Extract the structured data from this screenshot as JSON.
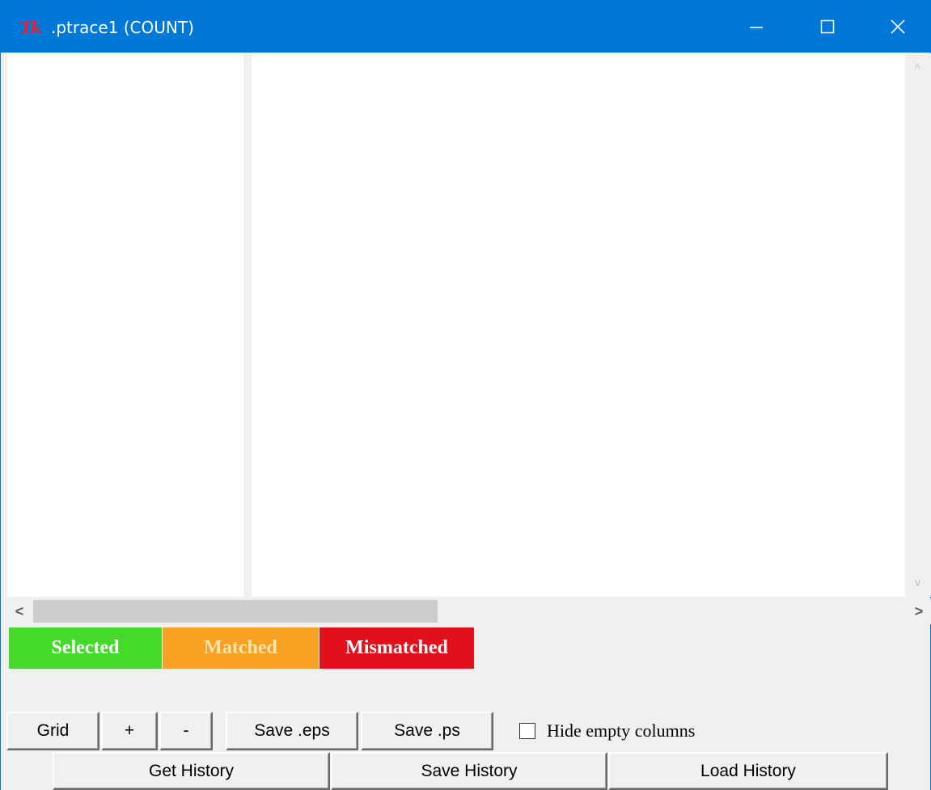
{
  "window": {
    "title": ".ptrace1 (COUNT)",
    "logo_text": "Tk",
    "controls": {
      "minimize_icon": "minimize-icon",
      "maximize_icon": "maximize-icon",
      "close_icon": "close-icon"
    },
    "accent_color": "#0078d7"
  },
  "scrollbars": {
    "vertical": {
      "up_glyph": "^",
      "down_glyph": "v"
    },
    "horizontal": {
      "left_glyph": "<",
      "right_glyph": ">"
    }
  },
  "legend": [
    {
      "label": "Selected",
      "bg": "#45d92b",
      "fg": "#ffffff"
    },
    {
      "label": "Matched",
      "bg": "#f8a122",
      "fg": "#fde5b0"
    },
    {
      "label": "Mismatched",
      "bg": "#e0101d",
      "fg": "#ffffff"
    }
  ],
  "toolbar": {
    "grid_label": "Grid",
    "zoom_in_label": "+",
    "zoom_out_label": "-",
    "save_eps_label": "Save .eps",
    "save_ps_label": "Save .ps",
    "hide_empty_label": "Hide empty columns",
    "hide_empty_checked": false
  },
  "history": {
    "get_label": "Get History",
    "save_label": "Save History",
    "load_label": "Load History"
  }
}
